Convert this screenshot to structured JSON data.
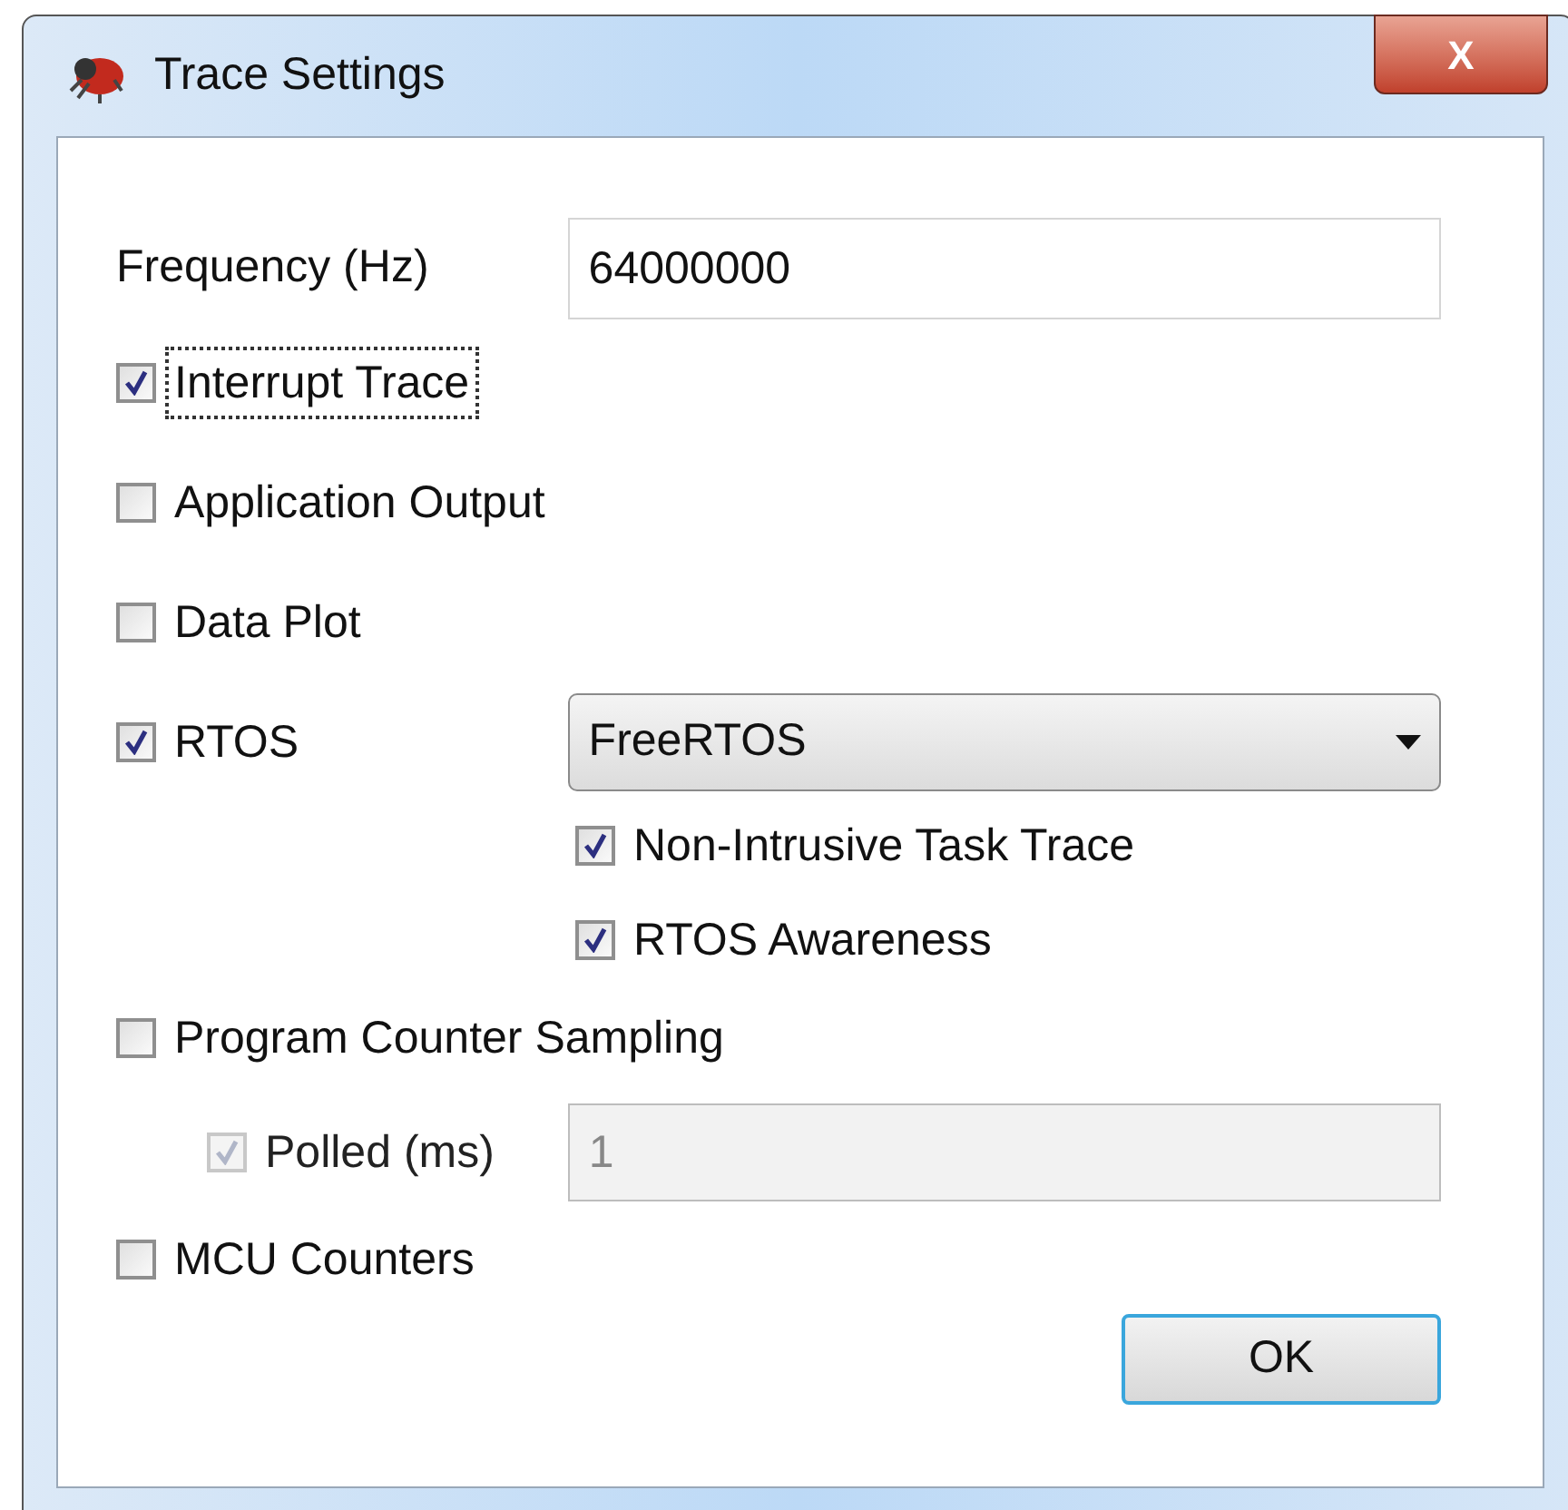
{
  "window": {
    "title": "Trace Settings",
    "close": "X"
  },
  "frequency": {
    "label": "Frequency (Hz)",
    "value": "64000000"
  },
  "rows": [
    {
      "kind": "check",
      "label": "Interrupt Trace",
      "checked": true,
      "focused": true,
      "disabled": false
    },
    {
      "kind": "check",
      "label": "Application Output",
      "checked": false,
      "focused": false,
      "disabled": false
    },
    {
      "kind": "check",
      "label": "Data Plot",
      "checked": false,
      "focused": false,
      "disabled": false
    },
    {
      "kind": "check_select",
      "label": "RTOS",
      "checked": true,
      "focused": false,
      "disabled": false,
      "select": "FreeRTOS"
    },
    {
      "kind": "sub_check",
      "label": "Non-Intrusive Task Trace",
      "checked": true,
      "focused": false,
      "disabled": false
    },
    {
      "kind": "sub_check",
      "label": "RTOS Awareness",
      "checked": true,
      "focused": false,
      "disabled": false
    },
    {
      "kind": "check",
      "label": "Program Counter Sampling",
      "checked": false,
      "focused": false,
      "disabled": false
    },
    {
      "kind": "indent_check_field",
      "label": "Polled (ms)",
      "checked": true,
      "focused": false,
      "disabled": true,
      "value": "1"
    },
    {
      "kind": "check",
      "label": "MCU Counters",
      "checked": false,
      "focused": false,
      "disabled": false
    }
  ],
  "ok_button": "OK"
}
